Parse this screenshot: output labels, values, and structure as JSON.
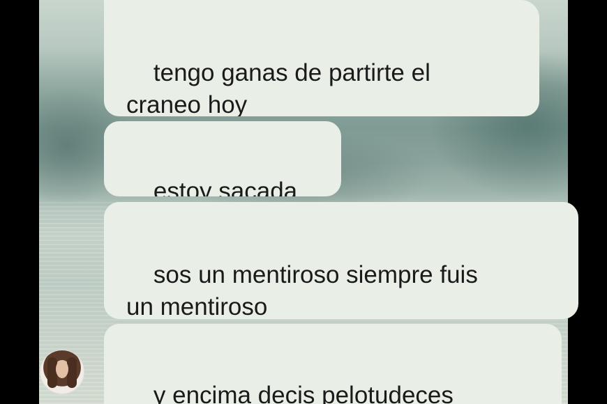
{
  "messages": [
    {
      "text": "tengo ganas de partirte el\ncraneo hoy"
    },
    {
      "text": "estoy sacada"
    },
    {
      "text": "sos un mentiroso siempre fuis\nun mentiroso"
    },
    {
      "text": "y encima decis pelotudeces"
    }
  ],
  "colors": {
    "bubble": "#e9efe7",
    "text": "#1a1a1a",
    "frame": "#000000"
  },
  "avatar": {
    "icon": "sender-avatar"
  }
}
